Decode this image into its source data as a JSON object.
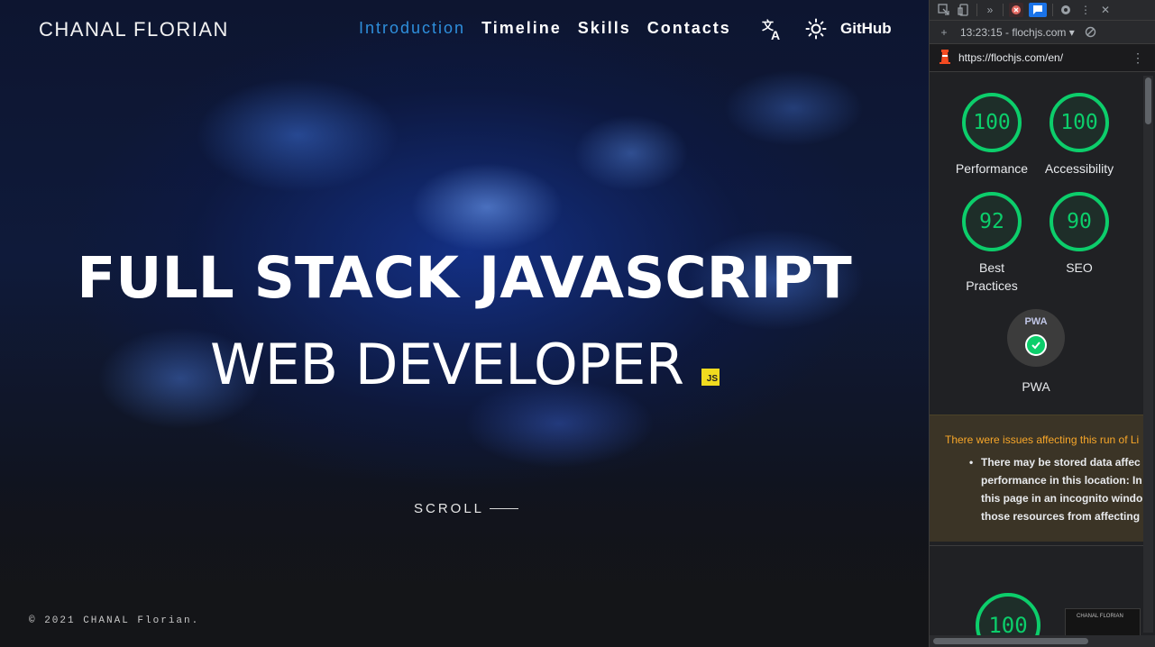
{
  "site": {
    "brand": "CHANAL FLORIAN",
    "nav": [
      "Introduction",
      "Timeline",
      "Skills",
      "Contacts"
    ],
    "github": "GitHub",
    "headline_1": "FULL STACK JAVASCRIPT",
    "headline_2": "WEB DEVELOPER",
    "badge": "JS",
    "scroll": "SCROLL",
    "copyright": "© 2021 CHANAL Florian.",
    "icons": [
      "translate-icon",
      "sun-icon"
    ],
    "accent_color": "#2e8fdc"
  },
  "devtools": {
    "run_label": "13:23:15 - flochjs.com",
    "url": "https://flochjs.com/en/",
    "scores": [
      {
        "label": "Performance",
        "score": "100"
      },
      {
        "label": "Accessibility",
        "score": "100"
      },
      {
        "label": "Best Practices",
        "score": "92"
      },
      {
        "label": "SEO",
        "score": "90"
      }
    ],
    "pwa_label": "PWA",
    "pwa_badge_text": "PWA",
    "warning_title": "There were issues affecting this run of Li",
    "warning_lines": [
      "There may be stored data affec",
      "performance in this location: In",
      "this page in an incognito windo",
      "those resources from affecting"
    ],
    "bottom_score": "100",
    "thumbnail_text": "CHANAL FLORIAN",
    "score_color": "#0cce6b",
    "warning_color": "#f7a629"
  }
}
